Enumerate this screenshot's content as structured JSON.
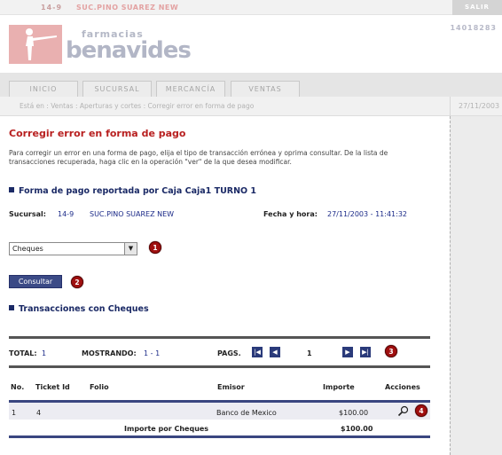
{
  "topbar": {
    "branch_code": "14-9",
    "branch_name": "SUC.PINO SUAREZ NEW",
    "logout_label": "SALIR"
  },
  "header": {
    "brand_small": "farmacias",
    "brand_big": "benavides",
    "session_id": "14018283"
  },
  "tabs": [
    {
      "label": "INICIO"
    },
    {
      "label": "SUCURSAL"
    },
    {
      "label": "MERCANCÍA"
    },
    {
      "label": "VENTAS"
    }
  ],
  "breadcrumb": {
    "text": "Está en : Ventas : Aperturas y cortes : Corregir error en forma de pago",
    "date": "27/11/2003"
  },
  "page": {
    "title": "Corregir error en forma de pago",
    "instructions": "Para corregir un error en una forma de pago, elija el tipo de transacción errónea y oprima consultar. De la lista de transacciones recuperada, haga clic en la operación \"ver\" de la que desea modificar."
  },
  "report_section": {
    "title": "Forma de pago reportada por Caja Caja1 TURNO 1"
  },
  "info": {
    "branch_label": "Sucursal:",
    "branch_code": "14-9",
    "branch_name": "SUC.PINO SUAREZ NEW",
    "datetime_label": "Fecha y hora:",
    "datetime_value": "27/11/2003 - 11:41:32"
  },
  "payment_select": {
    "value": "Cheques"
  },
  "consult_button": {
    "label": "Consultar"
  },
  "badges": {
    "one": "1",
    "two": "2",
    "three": "3",
    "four": "4"
  },
  "transactions_section": {
    "title": "Transacciones con Cheques"
  },
  "pager": {
    "total_label": "TOTAL:",
    "total_value": "1",
    "showing_label": "MOSTRANDO:",
    "showing_value": "1 - 1",
    "pages_label": "PAGS.",
    "current_page": "1"
  },
  "table": {
    "headers": {
      "no": "No.",
      "ticket": "Ticket Id",
      "folio": "Folio",
      "emisor": "Emisor",
      "importe": "Importe",
      "acciones": "Acciones"
    },
    "rows": [
      {
        "no": "1",
        "ticket": "4",
        "folio": "",
        "emisor": "Banco de Mexico",
        "importe": "$100.00"
      }
    ],
    "total_label": "Importe por Cheques",
    "total_value": "$100.00"
  },
  "colors": {
    "accent_red": "#b82020",
    "navy": "#1b2a66",
    "logo_pink": "#e9b0b0"
  }
}
